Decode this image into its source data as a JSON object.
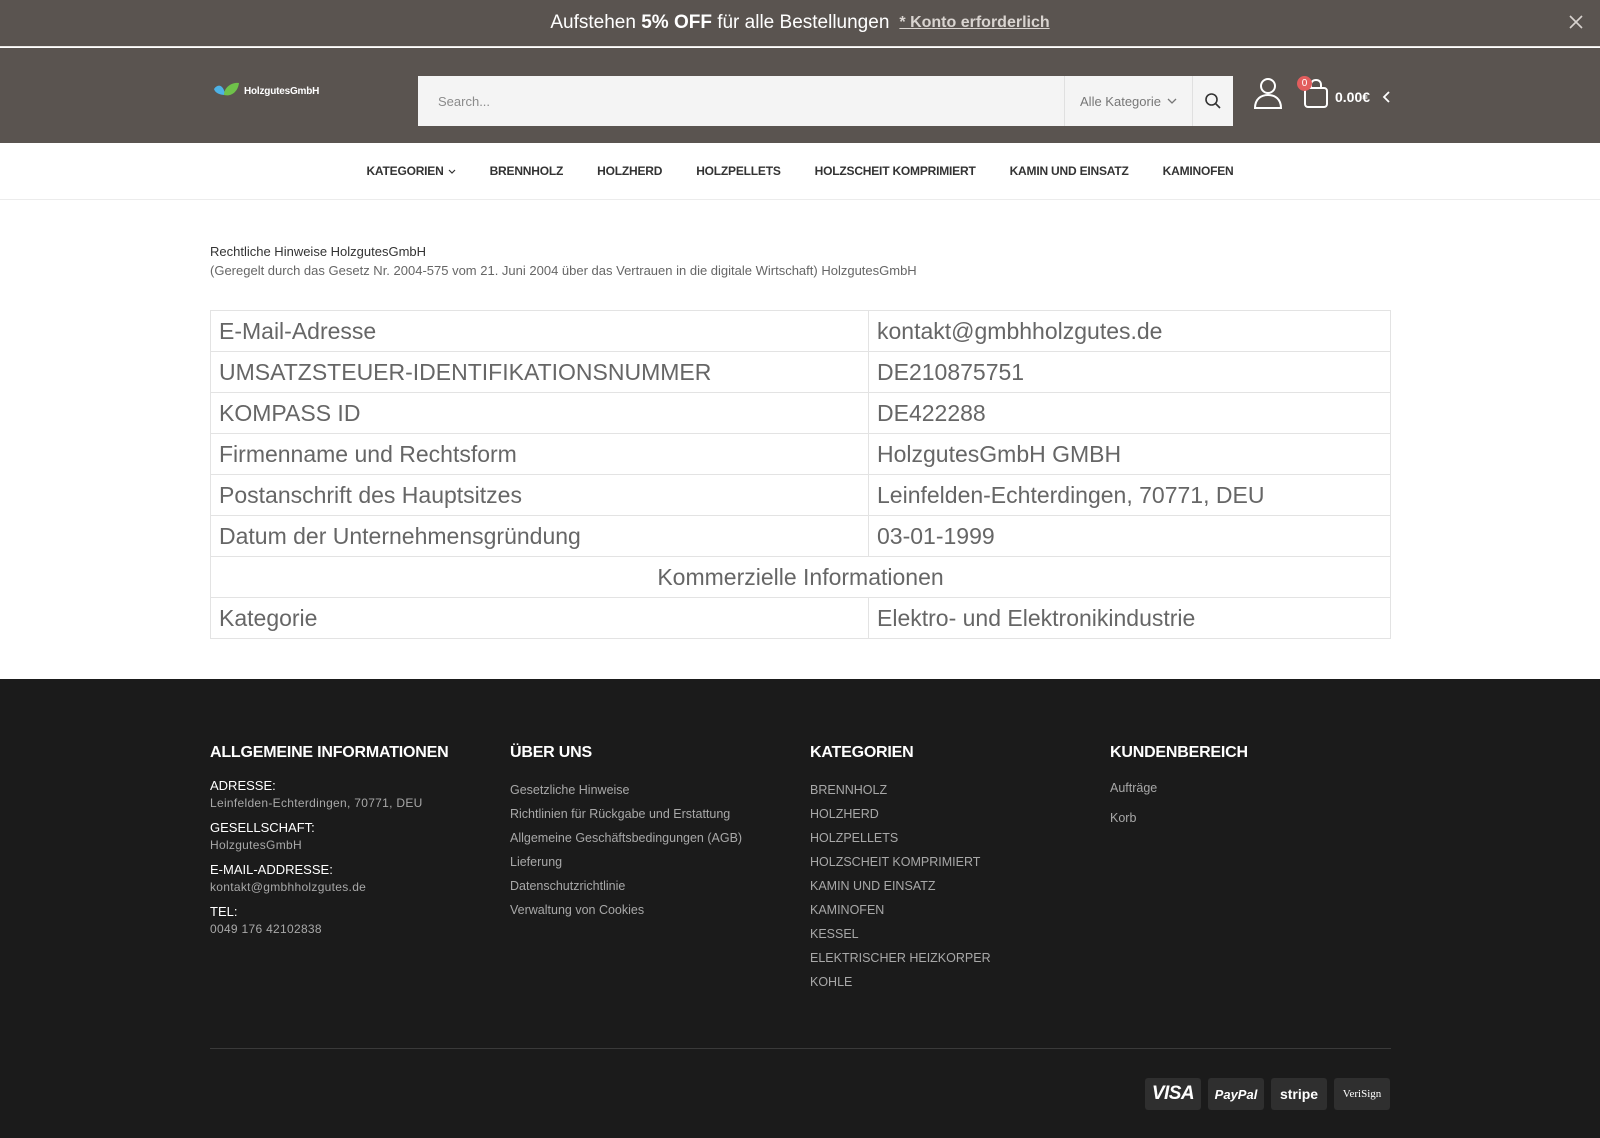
{
  "promo": {
    "text_prefix": "Aufstehen ",
    "text_bold": "5% OFF",
    "text_suffix": " für alle Bestellungen",
    "link": "* Konto erforderlich "
  },
  "header": {
    "logo_text": "HolzgutesGmbH",
    "search_placeholder": "Search...",
    "category_select": "Alle Kategorie",
    "cart_count": "0",
    "cart_total": "0.00€"
  },
  "nav": {
    "items": [
      "KATEGORIEN",
      "BRENNHOLZ",
      "HOLZHERD",
      "HOLZPELLETS",
      "HOLZSCHEIT KOMPRIMIERT",
      "KAMIN UND EINSATZ",
      "KAMINOFEN"
    ]
  },
  "intro": {
    "title": "Rechtliche Hinweise HolzgutesGmbH",
    "subtitle": "(Geregelt durch das Gesetz Nr. 2004-575 vom 21. Juni 2004 über das Vertrauen in die digitale Wirtschaft) HolzgutesGmbH"
  },
  "table": {
    "rows": [
      {
        "key": "E-Mail-Adresse",
        "value": "kontakt@gmbhholzgutes.de"
      },
      {
        "key": "UMSATZSTEUER-IDENTIFIKATIONSNUMMER",
        "value": "DE210875751"
      },
      {
        "key": "KOMPASS ID",
        "value": "DE422288"
      },
      {
        "key": "Firmenname und Rechtsform",
        "value": "HolzgutesGmbH GMBH"
      },
      {
        "key": "Postanschrift des Hauptsitzes",
        "value": "Leinfelden-Echterdingen, 70771, DEU"
      },
      {
        "key": "Datum der Unternehmensgründung",
        "value": "03-01-1999"
      }
    ],
    "section_header": "Kommerzielle Informationen",
    "last_row": {
      "key": "Kategorie",
      "value": "Elektro- und Elektronikindustrie"
    }
  },
  "footer": {
    "general": {
      "heading": "ALLGEMEINE INFORMATIONEN",
      "address_label": "ADRESSE:",
      "address_value": "Leinfelden-Echterdingen, 70771, DEU",
      "company_label": "GESELLSCHAFT:",
      "company_value": "HolzgutesGmbH",
      "email_label": "E-MAIL-ADDRESSE:",
      "email_value": "kontakt@gmbhholzgutes.de",
      "tel_label": "TEL:",
      "tel_value": "0049 176 42102838"
    },
    "about": {
      "heading": "ÜBER UNS",
      "links": [
        "Gesetzliche Hinweise",
        "Richtlinien für Rückgabe und Erstattung",
        "Allgemeine Geschäftsbedingungen (AGB)",
        "Lieferung",
        "Datenschutzrichtlinie",
        "Verwaltung von Cookies"
      ]
    },
    "categories": {
      "heading": "KATEGORIEN",
      "links": [
        "BRENNHOLZ",
        "HOLZHERD",
        "HOLZPELLETS",
        "HOLZSCHEIT KOMPRIMIERT",
        "KAMIN UND EINSATZ",
        "KAMINOFEN",
        "KESSEL",
        "ELEKTRISCHER HEIZKORPER",
        "KOHLE"
      ]
    },
    "customer": {
      "heading": "KUNDENBEREICH",
      "links": [
        "Aufträge",
        "Korb"
      ]
    },
    "payments": [
      "VISA",
      "PayPal",
      "stripe",
      "VeriSign"
    ]
  }
}
